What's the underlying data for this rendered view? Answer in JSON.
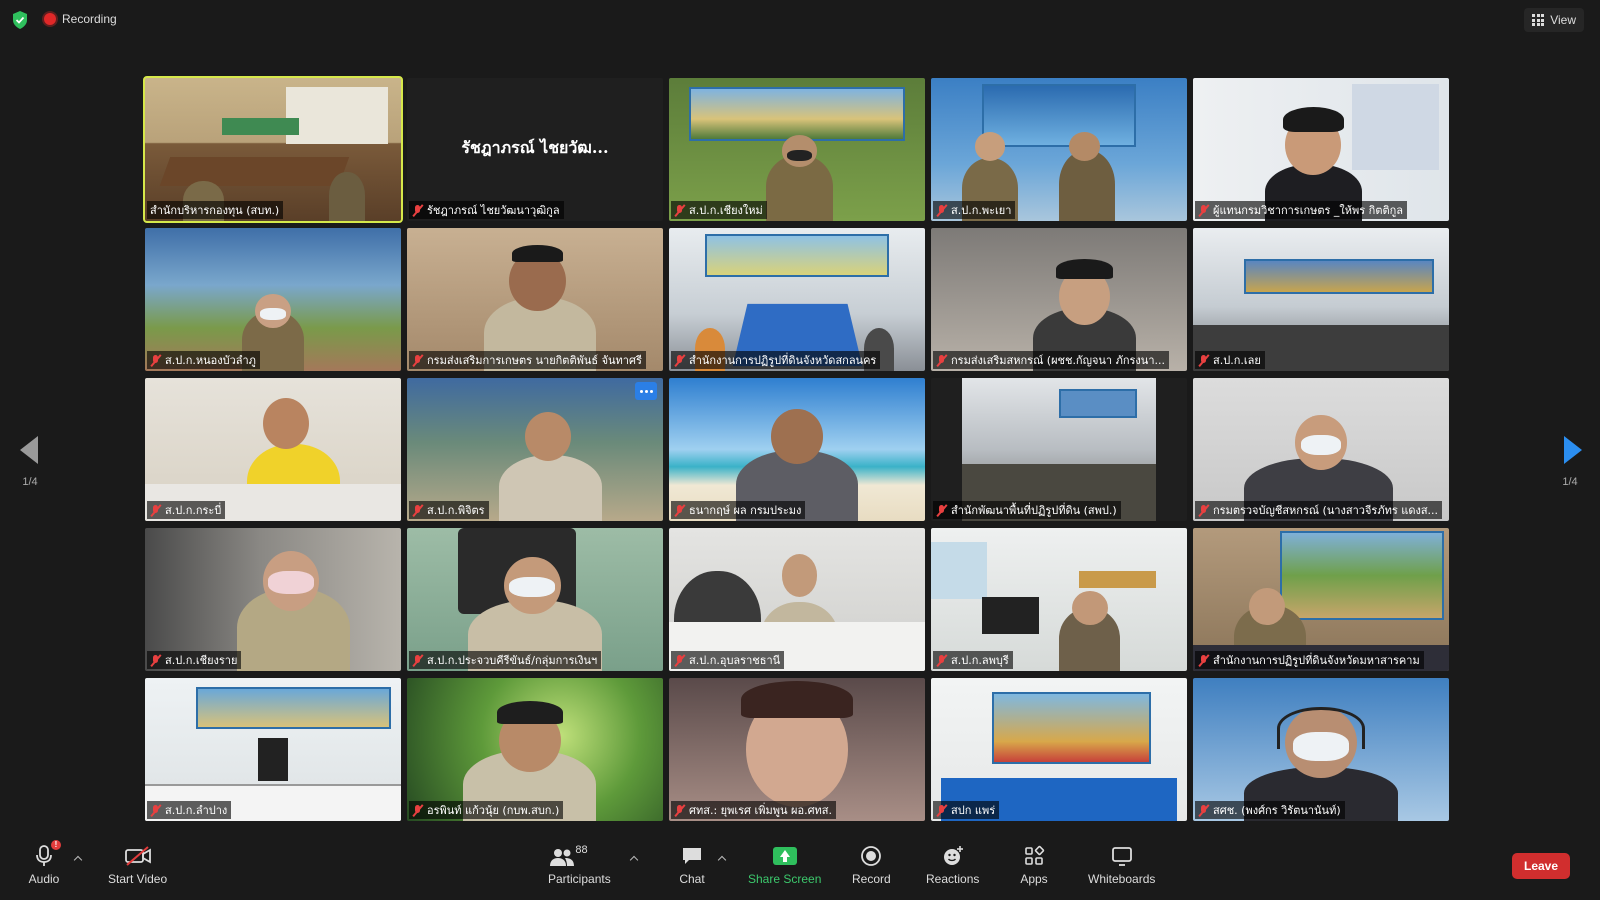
{
  "top_bar": {
    "security_icon": "shield-check-icon",
    "recording_label": "Recording",
    "view_label": "View"
  },
  "navigation": {
    "left_page_indicator": "1/4",
    "right_page_indicator": "1/4"
  },
  "tiles": [
    {
      "name": "สำนักบริหารกองทุน (สบท.)",
      "muted": false,
      "active": true
    },
    {
      "name": "รัชฎาภรณ์ ไชยวัฒนาวุฒิกูล",
      "display_title": "รัชฎาภรณ์ ไชยวัฒ...",
      "muted": true
    },
    {
      "name": "ส.ป.ก.เชียงใหม่",
      "muted": true
    },
    {
      "name": "ส.ป.ก.พะเยา",
      "muted": true
    },
    {
      "name": "ผู้แทนกรมวิชาการเกษตร _ให้พร กิตติกูล",
      "muted": true
    },
    {
      "name": "ส.ป.ก.หนองบัวลำภู",
      "muted": true
    },
    {
      "name": "กรมส่งเสริมการเกษตร นายกิตติพันธ์ จันทาศรี",
      "muted": true
    },
    {
      "name": "สำนักงานการปฏิรูปที่ดินจังหวัดสกลนคร",
      "muted": true
    },
    {
      "name": "กรมส่งเสริมสหกรณ์ (ผชช.กัญจนา ภักรงนา...",
      "muted": true
    },
    {
      "name": "ส.ป.ก.เลย",
      "muted": true
    },
    {
      "name": "ส.ป.ก.กระบี่",
      "muted": true
    },
    {
      "name": "ส.ป.ก.พิจิตร",
      "muted": true,
      "more_options": true
    },
    {
      "name": "ธนากฤษ์ ผล กรมประมง",
      "muted": true
    },
    {
      "name": "สำนักพัฒนาพื้นที่ปฏิรูปที่ดิน (สพป.)",
      "muted": true
    },
    {
      "name": "กรมตรวจบัญชีสหกรณ์ (นางสาวจีรภัทร แดงส...",
      "muted": true
    },
    {
      "name": "ส.ป.ก.เชียงราย",
      "muted": true
    },
    {
      "name": "ส.ป.ก.ประจวบคีรีขันธ์/กลุ่มการเงินฯ",
      "muted": true
    },
    {
      "name": "ส.ป.ก.อุบลราชธานี",
      "muted": true
    },
    {
      "name": "ส.ป.ก.ลพบุรี",
      "muted": true
    },
    {
      "name": "สำนักงานการปฏิรูปที่ดินจังหวัดมหาสารคาม",
      "muted": true
    },
    {
      "name": "ส.ป.ก.ลำปาง",
      "muted": true
    },
    {
      "name": "อรพินท์ แก้วนุ้ย (กบพ.สบก.)",
      "muted": true
    },
    {
      "name": "ศทส.: ยุพเรศ เพิ่มพูน ผอ.ศทส.",
      "muted": true
    },
    {
      "name": "สปก แพร่",
      "muted": true
    },
    {
      "name": "สศช. (พงศ์กร วิรัตนานันท์)",
      "muted": true
    }
  ],
  "toolbar": {
    "audio_label": "Audio",
    "audio_alert": "!",
    "start_video_label": "Start Video",
    "participants_label": "Participants",
    "participants_count": "88",
    "chat_label": "Chat",
    "share_screen_label": "Share Screen",
    "record_label": "Record",
    "reactions_label": "Reactions",
    "apps_label": "Apps",
    "whiteboards_label": "Whiteboards",
    "leave_label": "Leave"
  },
  "colors": {
    "background": "#1a1a1a",
    "active_speaker_border": "#d6e84a",
    "share_green": "#2fbf5d",
    "leave_red": "#d12e2e",
    "accent_blue": "#2b8ef0",
    "muted_red": "#e84040"
  }
}
